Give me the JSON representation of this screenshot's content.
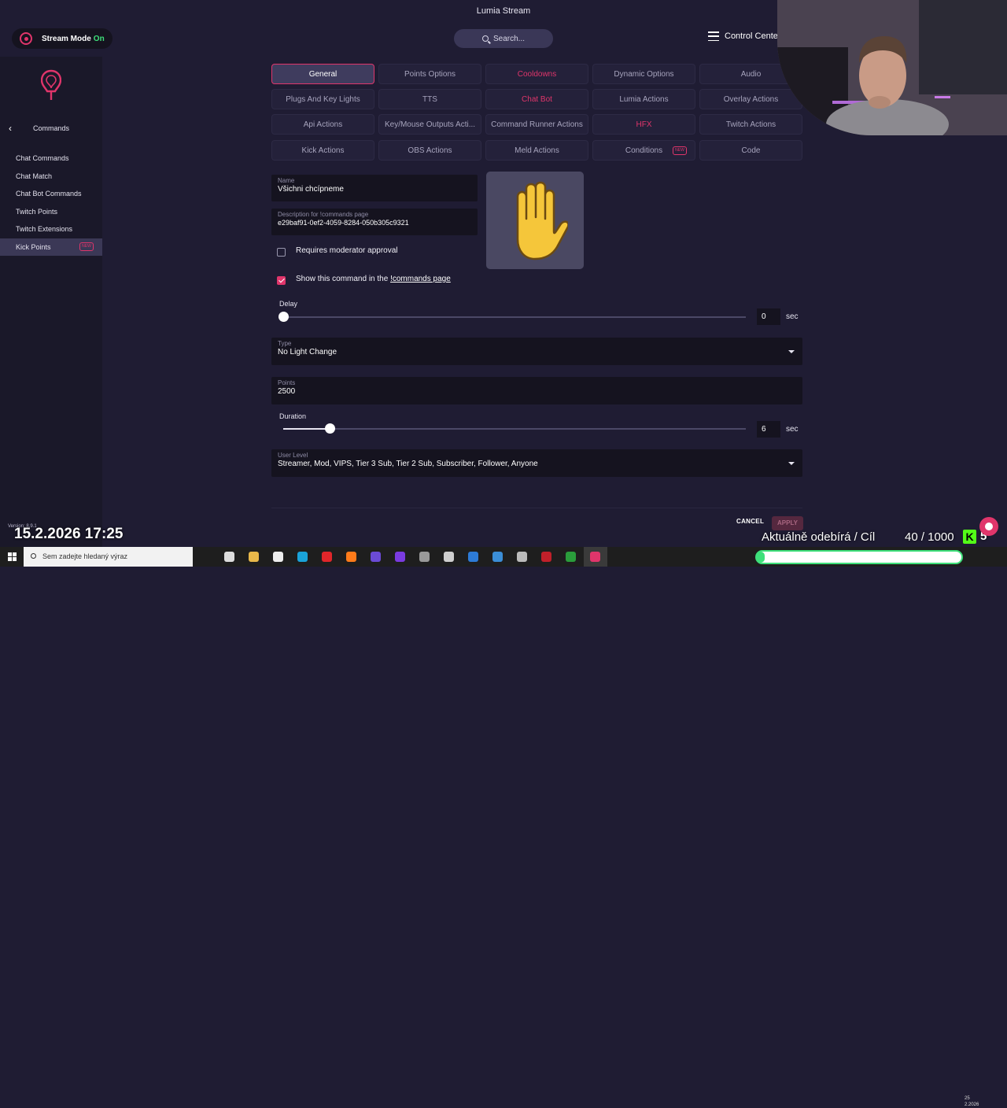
{
  "window": {
    "title": "Lumia Stream",
    "close": "✕"
  },
  "topbar": {
    "stream_mode_label": "Stream Mode",
    "stream_mode_state": "On",
    "search_label": "Search...",
    "control_center_label": "Control Center"
  },
  "sidebar": {
    "section_title": "Commands",
    "items": [
      {
        "label": "Chat Commands"
      },
      {
        "label": "Chat Match"
      },
      {
        "label": "Chat Bot Commands"
      },
      {
        "label": "Twitch Points"
      },
      {
        "label": "Twitch Extensions"
      },
      {
        "label": "Kick Points",
        "badge": "NEW"
      }
    ],
    "version": "Version: 8.9.1"
  },
  "tabs": [
    {
      "label": "General",
      "state": "active"
    },
    {
      "label": "Points Options"
    },
    {
      "label": "Cooldowns",
      "state": "pink"
    },
    {
      "label": "Dynamic Options"
    },
    {
      "label": "Audio"
    },
    {
      "label": "Plugs And Key Lights"
    },
    {
      "label": "TTS"
    },
    {
      "label": "Chat Bot",
      "state": "pink"
    },
    {
      "label": "Lumia Actions"
    },
    {
      "label": "Overlay Actions"
    },
    {
      "label": "Api Actions"
    },
    {
      "label": "Key/Mouse Outputs Acti..."
    },
    {
      "label": "Command Runner Actions"
    },
    {
      "label": "HFX",
      "state": "pink"
    },
    {
      "label": "Twitch Actions"
    },
    {
      "label": "Kick Actions"
    },
    {
      "label": "OBS Actions"
    },
    {
      "label": "Meld Actions"
    },
    {
      "label": "Conditions",
      "badge": "NEW"
    },
    {
      "label": "Code"
    }
  ],
  "form": {
    "name_label": "Name",
    "name_value": "Všichni chcípneme",
    "description_label": "Description for !commands page",
    "description_value": "e29baf91-0ef2-4059-8284-050b305c9321",
    "requires_mod_label": "Requires moderator approval",
    "requires_mod_checked": false,
    "show_command_label": "Show this command in the",
    "show_command_link": "!commands page",
    "show_command_checked": true,
    "delay_label": "Delay",
    "delay_value": "0",
    "delay_max": 60,
    "delay_unit": "sec",
    "type_label": "Type",
    "type_value": "No Light Change",
    "points_label": "Points",
    "points_value": "2500",
    "duration_label": "Duration",
    "duration_value": "6",
    "duration_max": 60,
    "duration_unit": "sec",
    "user_level_label": "User Level",
    "user_level_value": "Streamer, Mod, VIPS, Tier 3 Sub, Tier 2 Sub, Subscriber, Follower, Anyone",
    "cancel_label": "CANCEL",
    "apply_label": "APPLY",
    "emoji": "raised-hand"
  },
  "overlay": {
    "datetime": "15.2.2026 17:25",
    "goal_label": "Aktuálně odebírá / Cíl",
    "goal_count": "40 / 1000",
    "kick_letter": "K",
    "kick_count": "5",
    "goal_progress": 0.04
  },
  "taskbar": {
    "search_placeholder": "Sem zadejte hledaný výraz",
    "tray_time": "25",
    "tray_date": "2.2026"
  },
  "colors": {
    "accent": "#e0356b",
    "live_green": "#3ee07a",
    "bg": "#1f1c33"
  }
}
